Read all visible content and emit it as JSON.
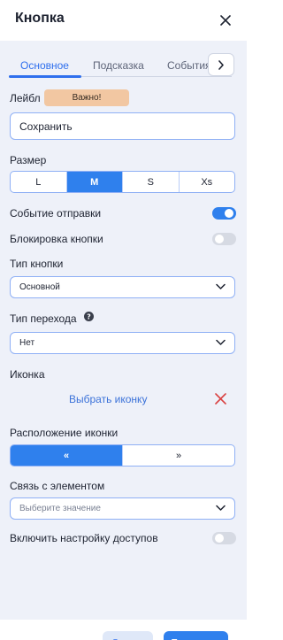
{
  "header": {
    "title": "Кнопка"
  },
  "tabs": [
    {
      "label": "Основное"
    },
    {
      "label": "Подсказка"
    },
    {
      "label": "События"
    }
  ],
  "label_field": {
    "label": "Лейбл",
    "badge": "Важно!",
    "value": "Сохранить"
  },
  "size": {
    "label": "Размер",
    "options": [
      "L",
      "M",
      "S",
      "Xs"
    ],
    "selected": "M"
  },
  "submit_event": {
    "label": "Событие отправки",
    "enabled": true
  },
  "block_button": {
    "label": "Блокировка кнопки",
    "enabled": false
  },
  "button_type": {
    "label": "Тип кнопки",
    "value": "Основной"
  },
  "transition_type": {
    "label": "Тип перехода",
    "value": "Нет"
  },
  "icon": {
    "label": "Иконка",
    "choose": "Выбрать иконку"
  },
  "icon_position": {
    "label": "Расположение иконки",
    "options": [
      "«",
      "»"
    ],
    "selected": "«"
  },
  "element_link": {
    "label": "Связь с элементом",
    "placeholder": "Выберите значение"
  },
  "access": {
    "label": "Включить настройку доступов",
    "enabled": false
  },
  "footer": {
    "cancel": "Отмена",
    "apply": "Применить"
  },
  "colors": {
    "accent": "#2f80ed",
    "badge": "#f2c7a2",
    "panel": "#eef1f9",
    "danger": "#d94141"
  }
}
